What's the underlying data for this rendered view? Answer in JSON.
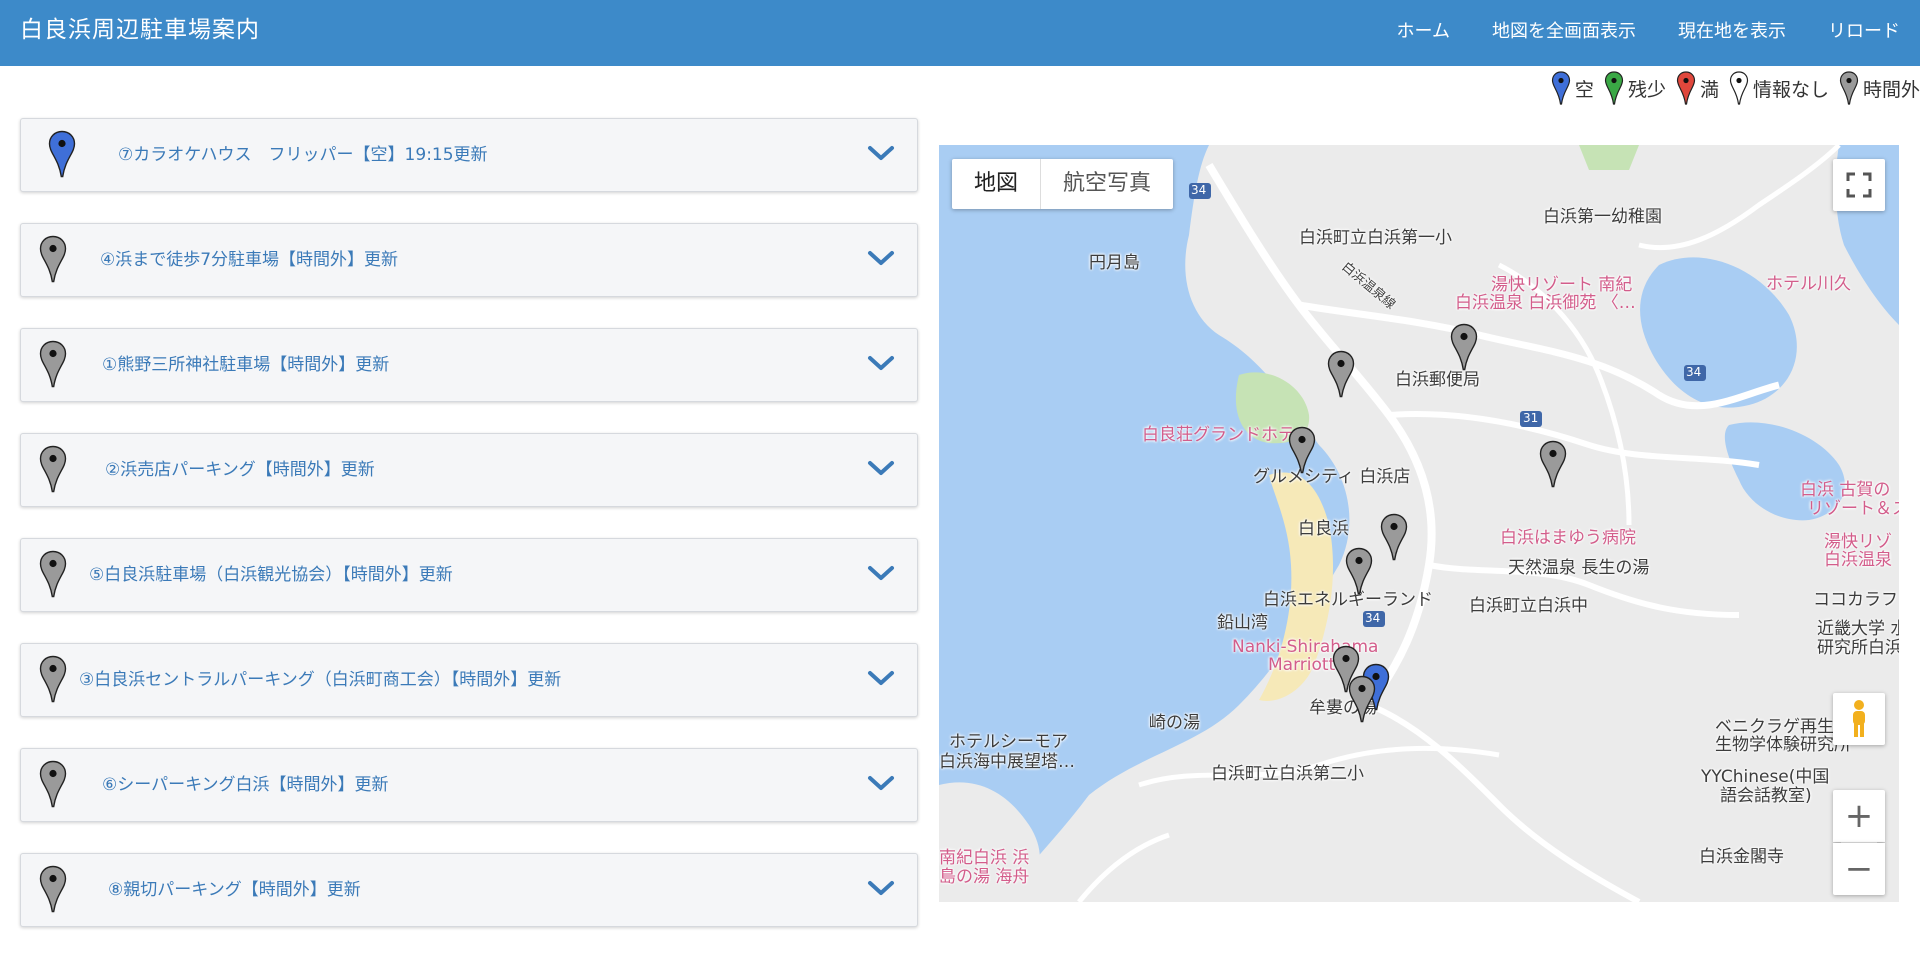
{
  "header": {
    "title": "白良浜周辺駐車場案内",
    "nav": [
      "ホーム",
      "地図を全画面表示",
      "現在地を表示",
      "リロード"
    ]
  },
  "legend": [
    {
      "label": "空",
      "color": "#3f6fd8"
    },
    {
      "label": "残少",
      "color": "#3aa845"
    },
    {
      "label": "満",
      "color": "#e0473c"
    },
    {
      "label": "情報なし",
      "color": "#ffffff"
    },
    {
      "label": "時間外",
      "color": "#9a9a9a"
    }
  ],
  "parking_list": [
    {
      "title": "⑦カラオケハウス　フリッパー【空】19:15更新",
      "status_color": "#3f6fd8"
    },
    {
      "title": "④浜まで徒歩7分駐車場【時間外】更新",
      "status_color": "#9a9a9a"
    },
    {
      "title": "①熊野三所神社駐車場【時間外】更新",
      "status_color": "#9a9a9a"
    },
    {
      "title": "②浜売店パーキング【時間外】更新",
      "status_color": "#9a9a9a"
    },
    {
      "title": "⑤白良浜駐車場（白浜観光協会）【時間外】更新",
      "status_color": "#9a9a9a"
    },
    {
      "title": "③白良浜セントラルパーキング（白浜町商工会）【時間外】更新",
      "status_color": "#9a9a9a"
    },
    {
      "title": "⑥シーパーキング白浜【時間外】更新",
      "status_color": "#9a9a9a"
    },
    {
      "title": "⑧親切パーキング【時間外】更新",
      "status_color": "#9a9a9a"
    }
  ],
  "map": {
    "type_buttons": {
      "map": "地図",
      "satellite": "航空写真"
    },
    "zoom_in": "+",
    "zoom_out": "−",
    "labels": [
      "円月島",
      "白浜町立白浜第一小",
      "白浜第一幼稚園",
      "白浜温泉線",
      "湯快リゾート 南紀",
      "白浜温泉 白浜御苑 〈…",
      "ホテル川久",
      "白浜郵便局",
      "白良荘グランドホテル",
      "グルメシティ 白浜店",
      "白良浜",
      "白浜はまゆう病院",
      "天然温泉 長生の湯",
      "白浜エネルギーランド",
      "白浜町立白浜中",
      "鉛山湾",
      "Nanki-Shirahama",
      "Marriott",
      "牟婁の湯",
      "崎の湯",
      "ホテルシーモア",
      "白浜海中展望塔…",
      "白浜町立白浜第二小",
      "ベニクラゲ再生",
      "生物学体験研究所",
      "YYChinese(中国",
      "語会話教室)",
      "白浜金閣寺",
      "近畿大学 水",
      "研究所白浜実",
      "ココカラフ",
      "白浜 古賀の",
      "リゾート＆ス",
      "湯快リゾ",
      "白浜温泉",
      "南紀白浜 浜",
      "島の湯 海舟",
      "34",
      "31"
    ]
  }
}
